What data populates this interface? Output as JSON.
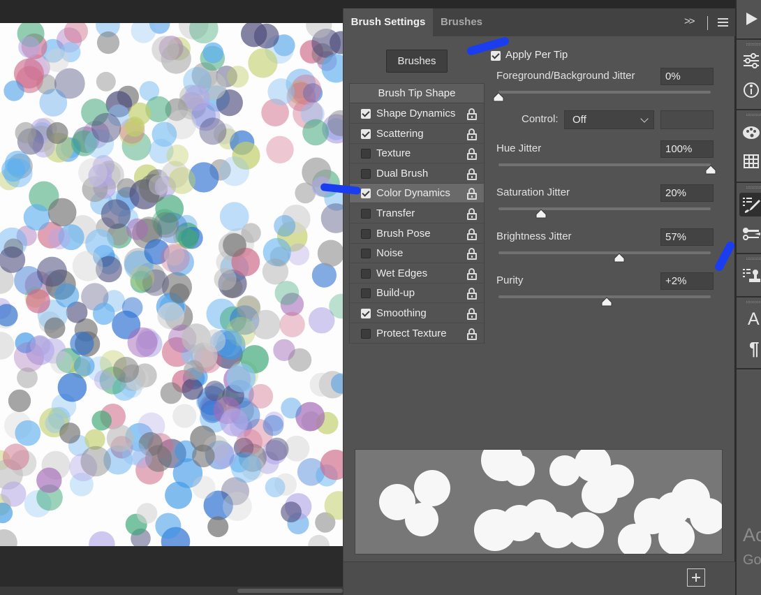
{
  "panel": {
    "tabs": [
      {
        "label": "Brush Settings",
        "active": true
      },
      {
        "label": "Brushes",
        "active": false
      }
    ],
    "expand_label": ">>",
    "brushes_button": "Brushes",
    "list_header": "Brush Tip Shape",
    "items": [
      {
        "label": "Shape Dynamics",
        "checked": true,
        "selected": false
      },
      {
        "label": "Scattering",
        "checked": true,
        "selected": false
      },
      {
        "label": "Texture",
        "checked": false,
        "selected": false
      },
      {
        "label": "Dual Brush",
        "checked": false,
        "selected": false
      },
      {
        "label": "Color Dynamics",
        "checked": true,
        "selected": true
      },
      {
        "label": "Transfer",
        "checked": false,
        "selected": false
      },
      {
        "label": "Brush Pose",
        "checked": false,
        "selected": false
      },
      {
        "label": "Noise",
        "checked": false,
        "selected": false
      },
      {
        "label": "Wet Edges",
        "checked": false,
        "selected": false
      },
      {
        "label": "Build-up",
        "checked": false,
        "selected": false
      },
      {
        "label": "Smoothing",
        "checked": true,
        "selected": false
      },
      {
        "label": "Protect Texture",
        "checked": false,
        "selected": false
      }
    ],
    "apply_per_tip": {
      "label": "Apply Per Tip",
      "checked": true
    },
    "fields": [
      {
        "label": "Foreground/Background Jitter",
        "value": "0%",
        "level": 0
      },
      {
        "label": "Hue Jitter",
        "value": "100%",
        "level": 1.0
      },
      {
        "label": "Saturation Jitter",
        "value": "20%",
        "level": 0.2
      },
      {
        "label": "Brightness Jitter",
        "value": "57%",
        "level": 0.57
      },
      {
        "label": "Purity",
        "value": "+2%",
        "level": 0.51
      }
    ],
    "control": {
      "label": "Control:",
      "value": "Off"
    }
  },
  "strip": {
    "icons": [
      "play-icon",
      "adjustments-icon",
      "info-icon",
      "palette-icon",
      "grid-icon",
      "brush-settings-icon",
      "brush-presets-icon",
      "clone-source-icon",
      "character-icon",
      "paragraph-icon"
    ],
    "text_a": "A",
    "text_pilcrow": "¶",
    "partial_1": "Ac",
    "partial_2": "Go"
  },
  "colors": {
    "marker": "#1b3df0",
    "panel_bg": "#535353",
    "canvas_bg": "#fdfdfd"
  }
}
